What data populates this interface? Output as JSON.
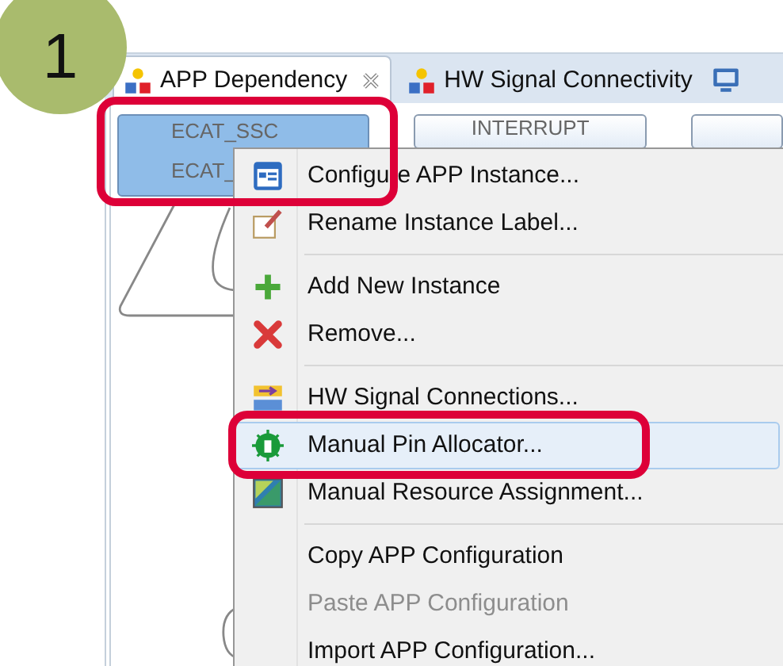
{
  "step_badge": "1",
  "tabs": [
    {
      "label": "APP Dependency",
      "selected": true,
      "closable": true
    },
    {
      "label": "HW Signal Connectivity",
      "selected": false,
      "closable": false
    }
  ],
  "nodes": [
    {
      "label": "ECAT_SSC",
      "sublabel": "ECAT_",
      "selected": true
    },
    {
      "label": "INTERRUPT",
      "selected": false
    }
  ],
  "context_menu": {
    "groups": [
      [
        {
          "label": "Configure APP Instance...",
          "disabled": false,
          "selected": false
        },
        {
          "label": "Rename Instance Label...",
          "disabled": false,
          "selected": false
        }
      ],
      [
        {
          "label": "Add New Instance",
          "disabled": false,
          "selected": false
        },
        {
          "label": "Remove...",
          "disabled": false,
          "selected": false
        }
      ],
      [
        {
          "label": "HW Signal Connections...",
          "disabled": false,
          "selected": false
        },
        {
          "label": "Manual Pin Allocator...",
          "disabled": false,
          "selected": true
        },
        {
          "label": "Manual Resource Assignment...",
          "disabled": false,
          "selected": false
        }
      ],
      [
        {
          "label": "Copy APP Configuration",
          "disabled": false,
          "selected": false
        },
        {
          "label": "Paste APP Configuration",
          "disabled": true,
          "selected": false
        },
        {
          "label": "Import APP Configuration...",
          "disabled": false,
          "selected": false
        }
      ]
    ]
  }
}
